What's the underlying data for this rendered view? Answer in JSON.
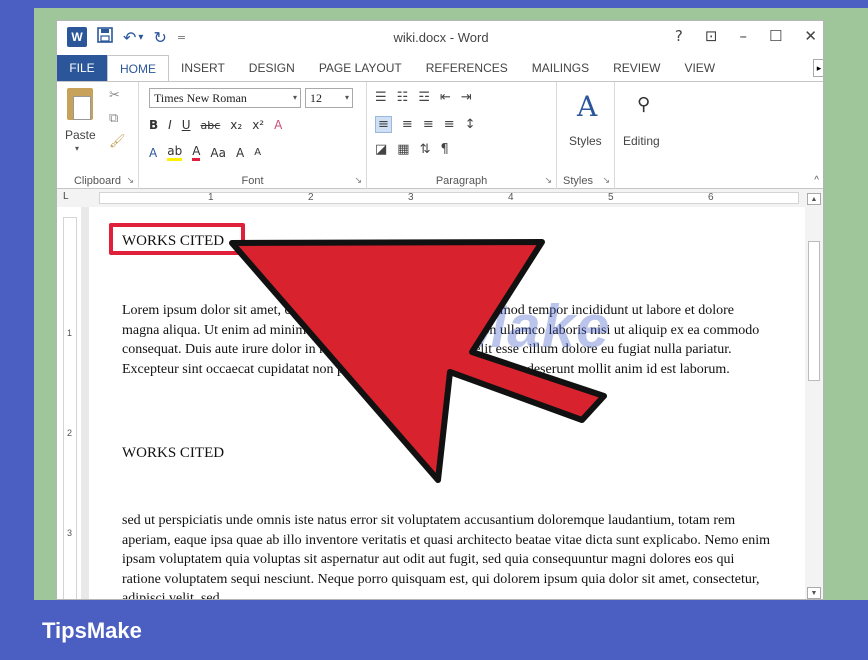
{
  "window": {
    "title": "wiki.docx - Word",
    "help": "?",
    "ribbon_options": "⊡",
    "minimize": "–",
    "maximize": "☐",
    "close": "✕"
  },
  "quick_access": {
    "app_icon": "W",
    "save": "💾",
    "undo": "↶",
    "undo_dd": "▾",
    "redo": "↻",
    "customize": "="
  },
  "tabs": [
    "FILE",
    "HOME",
    "INSERT",
    "DESIGN",
    "PAGE LAYOUT",
    "REFERENCES",
    "MAILINGS",
    "REVIEW",
    "VIEW"
  ],
  "ribbon": {
    "clipboard": {
      "paste": "Paste",
      "label": "Clipboard"
    },
    "font": {
      "name": "Times New Roman",
      "size": "12",
      "bold": "B",
      "italic": "I",
      "underline": "U",
      "strike": "abc",
      "sub": "x₂",
      "sup": "x²",
      "clear": "A",
      "highlight": "ab",
      "color": "A",
      "aa": "Aa",
      "grow": "A",
      "shrink": "A",
      "label": "Font"
    },
    "paragraph": {
      "label": "Paragraph",
      "pilcrow": "¶"
    },
    "styles": {
      "icon": "A",
      "label": "Styles",
      "group_label": "Styles"
    },
    "editing": {
      "label": "Editing"
    }
  },
  "ruler": {
    "numbers": [
      "1",
      "2",
      "3",
      "4",
      "5",
      "6"
    ]
  },
  "vruler": {
    "numbers": [
      "1",
      "2",
      "3"
    ]
  },
  "document": {
    "heading1": "WORKS CITED",
    "para1": "Lorem ipsum dolor sit amet, consectetur adipiscing elit, sed do eiusmod tempor incididunt ut labore et dolore magna aliqua. Ut enim ad minim veniam, quis nostrud exercitation ullamco laboris nisi ut aliquip ex ea commodo consequat. Duis aute irure dolor in reprehenderit in voluptate velit esse cillum dolore eu fugiat nulla pariatur. Excepteur sint occaecat cupidatat non proident, sunt in culpa qui officia deserunt mollit anim id est laborum.",
    "heading2": "WORKS CITED",
    "para2": "sed ut perspiciatis unde omnis iste natus error sit voluptatem accusantium doloremque laudantium, totam rem aperiam, eaque ipsa quae ab illo inventore veritatis et quasi architecto beatae vitae dicta sunt explicabo. Nemo enim ipsam voluptatem quia voluptas sit aspernatur aut odit aut fugit, sed quia consequuntur magni dolores eos qui ratione voluptatem sequi nesciunt. Neque porro quisquam est, qui dolorem ipsum quia dolor sit amet, consectetur, adipisci velit, sed"
  },
  "watermark": "TipsMake",
  "brand": "TipsMake",
  "colors": {
    "frame": "#4a5fc1",
    "word_blue": "#2b579a",
    "highlight_box": "#e0203a",
    "arrow": "#d8232f"
  }
}
